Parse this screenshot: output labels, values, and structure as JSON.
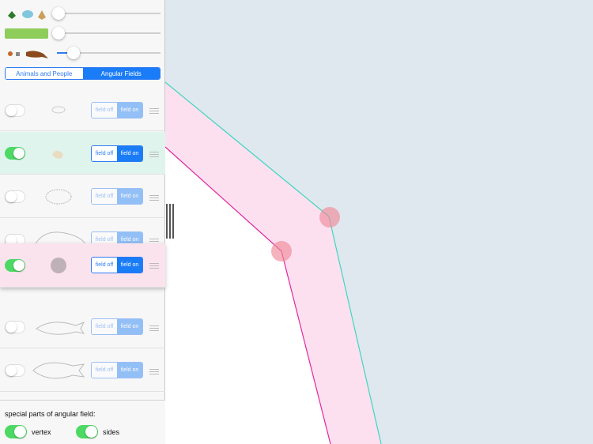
{
  "sidebar": {
    "segmented": {
      "left": "Animals and People",
      "right": "Angular Fields"
    },
    "sliders": [
      {
        "icon": "plants-icon",
        "value": 0.0
      },
      {
        "icon": "color-swatch-icon",
        "value": 0.0
      },
      {
        "icon": "animals-icon",
        "value": 0.15
      }
    ],
    "swatch_color": "#8fcd5b",
    "rows": [
      {
        "enabled": false,
        "field_off": "field off",
        "field_on": "field on",
        "highlight": ""
      },
      {
        "enabled": true,
        "field_off": "field off",
        "field_on": "field on",
        "highlight": "#dff4ec"
      },
      {
        "enabled": false,
        "field_off": "field off",
        "field_on": "field on",
        "highlight": ""
      },
      {
        "enabled": false,
        "field_off": "field off",
        "field_on": "field on",
        "highlight": ""
      },
      {
        "enabled": true,
        "field_off": "field off",
        "field_on": "field on",
        "highlight": "#fbe3ee"
      },
      {
        "enabled": false,
        "field_off": "field off",
        "field_on": "field on",
        "highlight": ""
      },
      {
        "enabled": false,
        "field_off": "field off",
        "field_on": "field on",
        "highlight": ""
      }
    ],
    "footer": {
      "title": "special parts of angular field:",
      "vertex_label": "vertex",
      "sides_label": "sides",
      "vertex_on": true,
      "sides_on": true
    }
  },
  "canvas": {
    "background": "#dfe8ee",
    "band_color": "#fde0f0",
    "outer_line_color": "#3fd6c0",
    "inner_line_color": "#e0289f"
  }
}
